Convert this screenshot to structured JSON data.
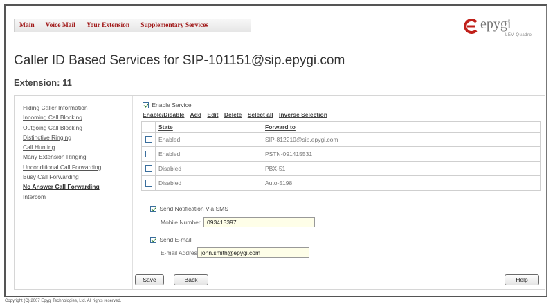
{
  "nav": {
    "items": [
      "Main",
      "Voice Mail",
      "Your Extension",
      "Supplementary Services"
    ]
  },
  "logo": {
    "name": "epygi",
    "subtitle": "LEV·Quadro"
  },
  "page": {
    "title": "Caller ID Based Services for SIP-101151@sip.epygi.com",
    "extension": "Extension: 11"
  },
  "sidebar": {
    "items": [
      "Hiding Caller Information",
      "Incoming Call Blocking",
      "Outgoing Call Blocking",
      "Distinctive Ringing",
      "Call Hunting",
      "Many Extension Ringing",
      "Unconditional Call Forwarding",
      "Busy Call Forwarding",
      "No Answer Call Forwarding",
      "Intercom"
    ],
    "active": "No Answer Call Forwarding"
  },
  "service": {
    "enable_label": "Enable Service",
    "enabled": true
  },
  "actions": [
    "Enable/Disable",
    "Add",
    "Edit",
    "Delete",
    "Select all",
    "Inverse Selection"
  ],
  "table": {
    "headers": [
      "State",
      "Forward to"
    ],
    "rows": [
      {
        "state": "Enabled",
        "forward_to": "SIP-812210@sip.epygi.com",
        "checked": false
      },
      {
        "state": "Enabled",
        "forward_to": "PSTN-091415531",
        "checked": false
      },
      {
        "state": "Disabled",
        "forward_to": "PBX-51",
        "checked": false
      },
      {
        "state": "Disabled",
        "forward_to": "Auto-5198",
        "checked": false
      }
    ]
  },
  "sms": {
    "label": "Send Notification Via SMS",
    "checked": true,
    "mobile_label": "Mobile Number",
    "mobile_value": "093413397"
  },
  "email": {
    "label": "Send E-mail",
    "checked": true,
    "address_label": "E-mail Address",
    "address_value": "john.smith@epygi.com"
  },
  "buttons": {
    "save": "Save",
    "back": "Back",
    "help": "Help"
  },
  "footer": {
    "prefix": "Copyright (C) 2007",
    "link": "Epygi Technologies, Ltd.",
    "suffix": "All rights reserved."
  },
  "colors": {
    "nav_text": "#a01818",
    "logo_red": "#c0201a",
    "input_bg": "#fefee8"
  }
}
